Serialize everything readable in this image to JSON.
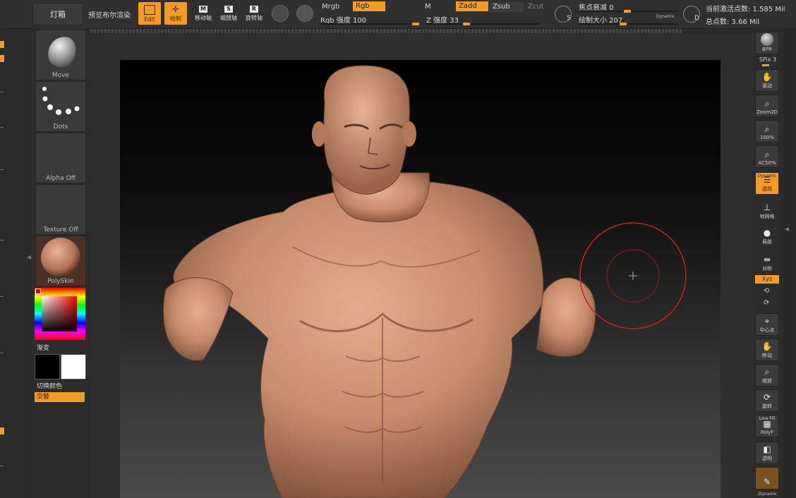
{
  "toolbar": {
    "light_box": "灯箱",
    "preview_bool": "预览布尔渲染",
    "edit": "Edit",
    "draw": "绘制",
    "move_tool": "移动轴",
    "scale_tool": "缩放轴",
    "rotate_tool": "旋转轴",
    "move_key": "M",
    "scale_key": "S",
    "rotate_key": "R",
    "mrgb": "Mrgb",
    "rgb": "Rgb",
    "m": "M",
    "zadd": "Zadd",
    "zsub": "Zsub",
    "zcut": "Zcut",
    "rgb_intensity": "Rgb 强度 100",
    "z_intensity": "Z 强度 33",
    "rgb_intensity_value": 100,
    "z_intensity_value": 33,
    "focal_shift": "焦点衰减 0",
    "draw_size": "绘制大小 207",
    "dynamic": "Dynamic",
    "active_points": "当前激活点数: 1.585 Mil",
    "total_points": "总点数: 3.66 Mil",
    "s_key": "S",
    "d_key": "D"
  },
  "left_palette": {
    "brush": "Move",
    "stroke": "Dots",
    "alpha": "Alpha Off",
    "texture": "Texture Off",
    "material": "PolySkin",
    "gradient": "渐变",
    "switch_color": "切换颜色",
    "alternate": "交替"
  },
  "right_shelf": {
    "bpr": "BPR",
    "spix": "SPix 3",
    "scroll": "滚动",
    "zoom2d": "Zoom2D",
    "actual": "100%",
    "half": "AC50%",
    "dynamic": "Dynamic",
    "perspective": "透视",
    "floor": "地网格",
    "local": "局部",
    "gizmo": "对称",
    "xyz": "Xyz",
    "frame": "中心点",
    "move": "移动",
    "zoom": "缩放",
    "rotate": "旋转",
    "line_fill": "Line Fill",
    "polyf": "PolyF",
    "transp": "透明",
    "ghost": "Dynamic"
  },
  "colors": {
    "accent": "#f39b22",
    "brush_ring": "#c4231f",
    "skin": "#c98e6e"
  }
}
